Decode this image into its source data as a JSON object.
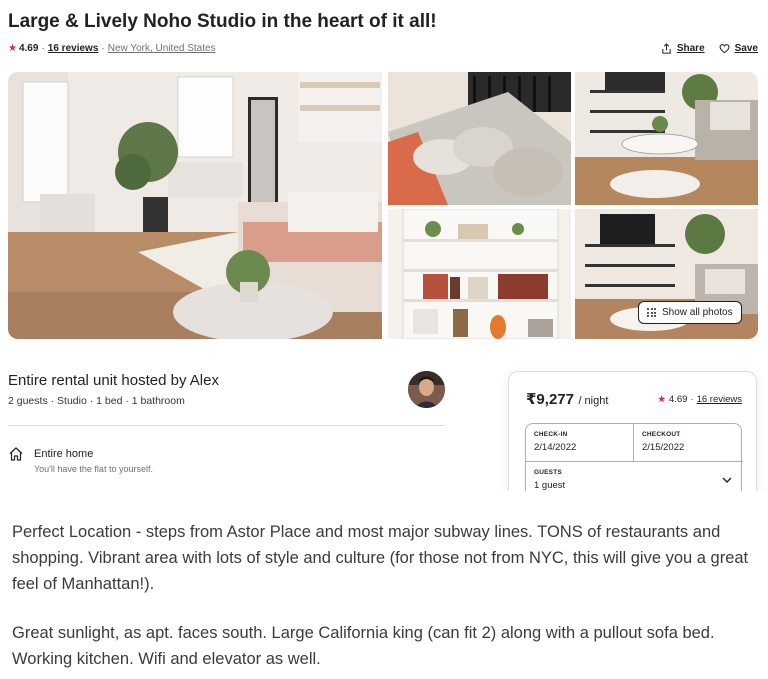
{
  "listing": {
    "title": "Large & Lively Noho Studio in the heart of it all!",
    "rating": "4.69",
    "reviews": "16 reviews",
    "location": "New York, United States",
    "share_label": "Share",
    "save_label": "Save"
  },
  "gallery": {
    "show_all_label": "Show all photos"
  },
  "host": {
    "title": "Entire rental unit hosted by Alex",
    "details": "2 guests · Studio · 1 bed · 1 bathroom"
  },
  "features": [
    {
      "icon": "home-icon",
      "title": "Entire home",
      "description": "You'll have the flat to yourself."
    }
  ],
  "booking": {
    "price": "₹9,277",
    "per": "/ night",
    "rating": "4.69",
    "reviews": "16 reviews",
    "checkin_label": "CHECK-IN",
    "checkin_value": "2/14/2022",
    "checkout_label": "CHECKOUT",
    "checkout_value": "2/15/2022",
    "guests_label": "GUESTS",
    "guests_value": "1 guest"
  },
  "caption": {
    "paragraph1": "Perfect Location - steps from Astor Place and most major subway lines. TONS of restaurants and shopping. Vibrant area with lots of style and culture (for those not from NYC, this will give you a great feel of Manhattan!).",
    "paragraph2": "Great sunlight, as apt. faces south. Large California king (can fit 2) along with a pullout sofa bed. Working kitchen. Wifi and elevator as well."
  },
  "colors": {
    "accent": "#e31c5f",
    "text": "#222222",
    "muted": "#717171",
    "border": "#dddddd"
  }
}
